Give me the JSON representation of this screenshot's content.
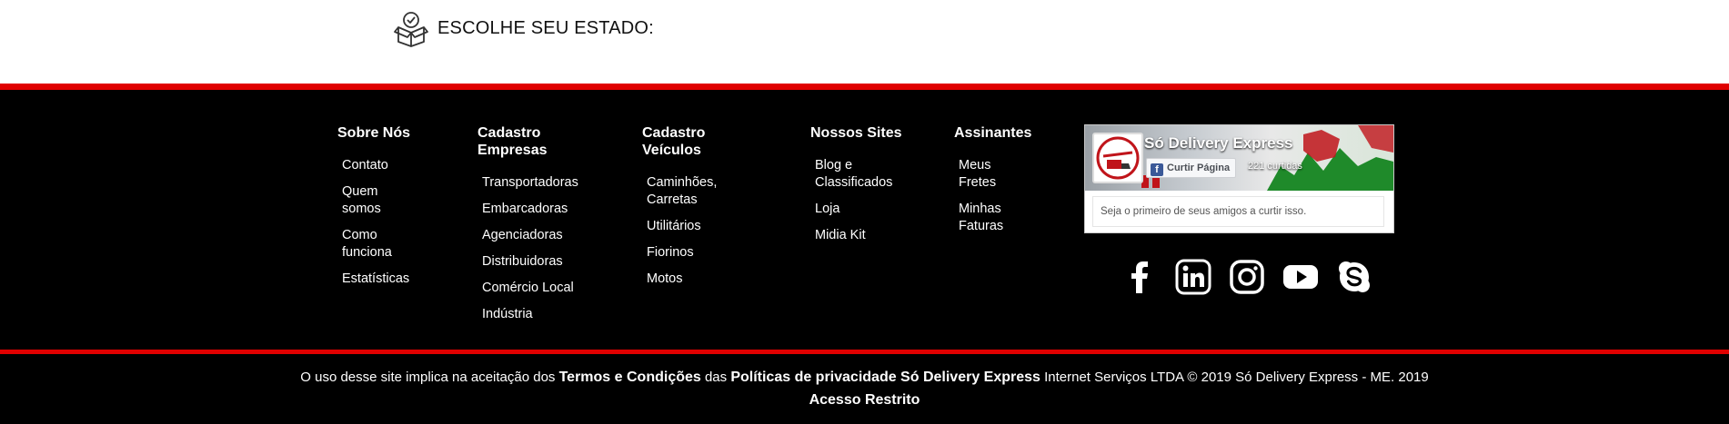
{
  "state_selector": {
    "label": "ESCOLHE SEU ESTADO:",
    "icon": "box-check-icon"
  },
  "footer": {
    "columns": [
      {
        "title": "Sobre Nós",
        "items": [
          "Contato",
          "Quem somos",
          "Como funciona",
          "Estatísticas"
        ]
      },
      {
        "title": "Cadastro Empresas",
        "items": [
          "Transportadoras",
          "Embarcadoras",
          "Agenciadoras",
          "Distribuidoras",
          "Comércio Local",
          "Indústria"
        ]
      },
      {
        "title": "Cadastro Veículos",
        "items": [
          "Caminhões, Carretas",
          "Utilitários",
          "Fiorinos",
          "Motos"
        ]
      },
      {
        "title": "Nossos Sites",
        "items": [
          "Blog e Classificados",
          "Loja",
          "Midia Kit"
        ]
      },
      {
        "title": "Assinantes",
        "items": [
          "Meus Fretes",
          "Minhas Faturas"
        ]
      }
    ],
    "facebook": {
      "page_name": "Só Delivery Express",
      "like_label": "Curtir Página",
      "likes": "221 curtidas",
      "friends_text": "Seja o primeiro de seus amigos a curtir isso."
    },
    "social_icons": [
      "facebook-icon",
      "linkedin-icon",
      "instagram-icon",
      "youtube-icon",
      "skype-icon"
    ]
  },
  "legal": {
    "prefix": "O uso desse site implica na aceitação dos",
    "terms_link": "Termos e Condições",
    "middle": "das",
    "privacy_link": "Políticas de privacidade Só Delivery Express",
    "suffix": "Internet Serviços LTDA © 2019 Só Delivery Express - ME. 2019",
    "restricted_link": "Acesso Restrito"
  },
  "colors": {
    "accent": "#e00000",
    "footer_bg": "#000000",
    "facebook": "#3b5998"
  }
}
